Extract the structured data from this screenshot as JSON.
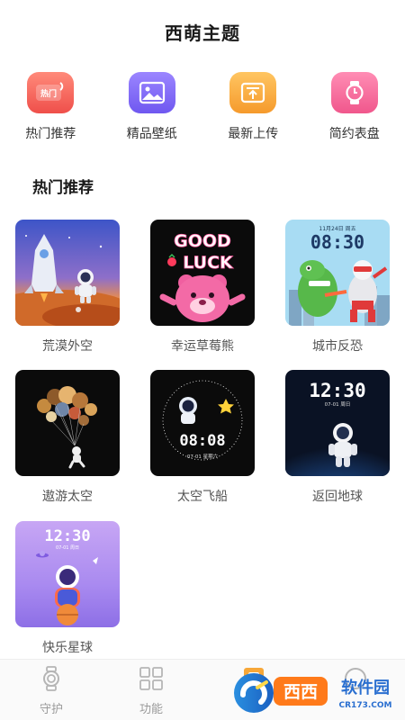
{
  "header": {
    "title": "西萌主题"
  },
  "quick_nav": [
    {
      "label": "热门推荐",
      "icon": "hot-icon",
      "icon_text": "热门",
      "color": "#f0635d"
    },
    {
      "label": "精品壁纸",
      "icon": "wallpaper-icon",
      "color": "#8a72f5"
    },
    {
      "label": "最新上传",
      "icon": "upload-icon",
      "color": "#f7a738"
    },
    {
      "label": "简约表盘",
      "icon": "watch-icon",
      "color": "#f56b9a"
    }
  ],
  "section": {
    "title": "热门推荐"
  },
  "items": [
    {
      "label": "荒漠外空",
      "bg": "#f08a3a"
    },
    {
      "label": "幸运草莓熊",
      "bg": "#0b0b0b",
      "text1": "GOOD",
      "text2": "LUCK"
    },
    {
      "label": "城市反恐",
      "bg": "#9ed4ef",
      "date": "11月24日 周五",
      "time": "08:30"
    },
    {
      "label": "遨游太空",
      "bg": "#0b0b0b"
    },
    {
      "label": "太空飞船",
      "bg": "#0b0b0b",
      "time": "08:08",
      "date": "07-01  星期六"
    },
    {
      "label": "返回地球",
      "bg": "#0c1428",
      "time": "12:30",
      "date": "07-01   周日"
    },
    {
      "label": "快乐星球",
      "bg": "#b48cf0",
      "time": "12:30",
      "date": "07-01  周日"
    }
  ],
  "tabbar": [
    {
      "label": "守护",
      "icon": "watch-outline-icon"
    },
    {
      "label": "功能",
      "icon": "grid-icon"
    },
    {
      "label": "",
      "icon": "theme-icon"
    },
    {
      "label": "",
      "icon": "profile-icon"
    }
  ],
  "watermark": {
    "text1": "西西",
    "text2": "软件园",
    "text3": "CR173.COM"
  }
}
